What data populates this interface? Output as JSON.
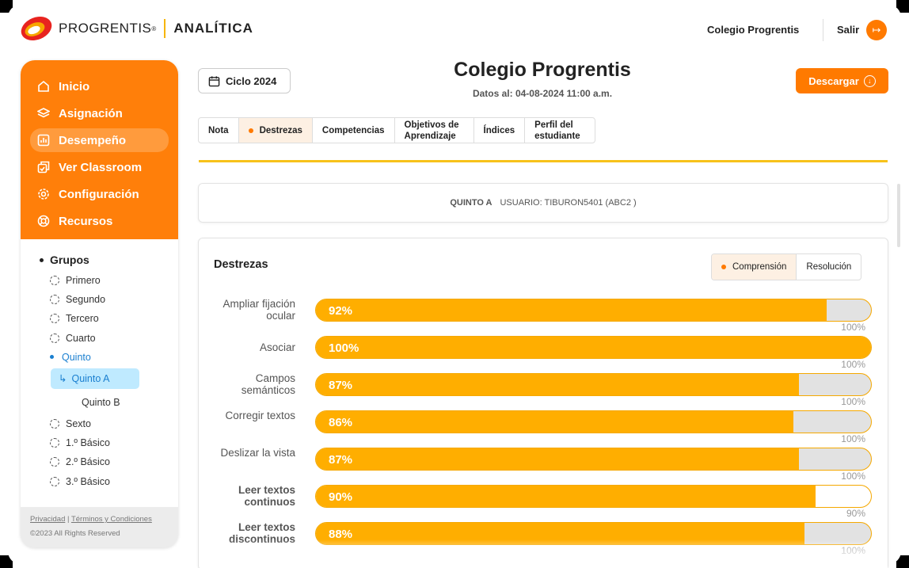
{
  "header": {
    "brand": "PROGRENTIS",
    "brand_reg": "®",
    "product": "ANALÍTICA",
    "school": "Colegio Progrentis",
    "exit_label": "Salir"
  },
  "sidebar": {
    "nav": [
      {
        "label": "Inicio",
        "icon": "home-icon"
      },
      {
        "label": "Asignación",
        "icon": "layers-icon"
      },
      {
        "label": "Desempeño",
        "icon": "chart-icon",
        "active": true
      },
      {
        "label": "Ver Classroom",
        "icon": "classroom-icon"
      },
      {
        "label": "Configuración",
        "icon": "gear-icon"
      },
      {
        "label": "Recursos",
        "icon": "lifebuoy-icon"
      }
    ],
    "groups_title": "Grupos",
    "groups": [
      "Primero",
      "Segundo",
      "Tercero",
      "Cuarto",
      "Quinto",
      "Sexto",
      "1.º Básico",
      "2.º Básico",
      "3.º Básico"
    ],
    "selected_group": "Quinto",
    "subgroups": [
      "Quinto A",
      "Quinto B"
    ],
    "selected_subgroup": "Quinto A",
    "footer": {
      "privacy": "Privacidad",
      "sep": "|",
      "terms": "Términos y Condiciones",
      "copyright": "©2023 All Rights Reserved"
    }
  },
  "main": {
    "cycle": "Ciclo 2024",
    "title": "Colegio Progrentis",
    "date": "Datos al: 04-08-2024 11:00 a.m.",
    "download": "Descargar",
    "tabs": [
      {
        "label": "Nota"
      },
      {
        "label": "Destrezas",
        "active": true
      },
      {
        "label": "Competencias"
      },
      {
        "label": "Objetivos de Aprendizaje"
      },
      {
        "label": "Índices"
      },
      {
        "label": "Perfil del estudiante"
      }
    ],
    "info": {
      "class": "QUINTO A",
      "user": "USUARIO: TIBURON5401 (ABC2 )"
    },
    "skills": {
      "title": "Destrezas",
      "toggle": [
        "Comprensión",
        "Resolución"
      ],
      "toggle_active": "Comprensión",
      "rows": [
        {
          "label": "Ampliar fijación ocular",
          "value": 92,
          "max_label": "100%",
          "bold": false
        },
        {
          "label": "Asociar",
          "value": 100,
          "max_label": "100%",
          "bold": false
        },
        {
          "label": "Campos semánticos",
          "value": 87,
          "max_label": "100%",
          "bold": false
        },
        {
          "label": "Corregir textos",
          "value": 86,
          "max_label": "100%",
          "bold": false
        },
        {
          "label": "Deslizar la vista",
          "value": 87,
          "max_label": "100%",
          "bold": false
        },
        {
          "label": "Leer textos continuos",
          "value": 90,
          "max_label": "90%",
          "bold": true
        },
        {
          "label": "Leer textos discontinuos",
          "value": 88,
          "max_label": "100%",
          "bold": true
        }
      ]
    }
  },
  "colors": {
    "accent": "#ff7a00",
    "bar": "#ffae00",
    "rule": "#f7c21a",
    "link": "#1a7fd0"
  }
}
